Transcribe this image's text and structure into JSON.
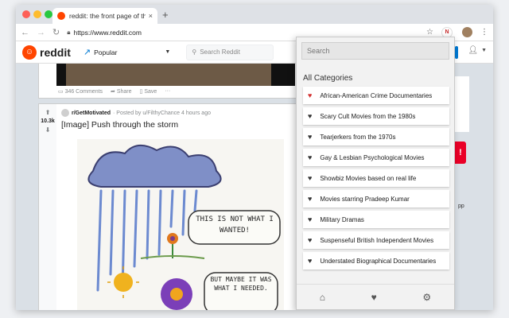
{
  "browser": {
    "tab_title": "reddit: the front page of the in",
    "tab_close": "×",
    "new_tab": "+",
    "url": "https://www.reddit.com",
    "extension_label": "N"
  },
  "reddit": {
    "wordmark": "reddit",
    "feed_selector": "Popular",
    "search_placeholder": "Search Reddit"
  },
  "post_prev": {
    "comments": "346 Comments",
    "share": "Share",
    "save": "Save",
    "more": "···"
  },
  "post": {
    "score": "10.3k",
    "subreddit": "r/GetMotivated",
    "posted_by": "· Posted by u/FilthyChance 4 hours ago",
    "title": "[Image] Push through the storm",
    "bubble1": "THIS IS NOT WHAT I WANTED!",
    "bubble2": "BUT MAYBE IT WAS WHAT I NEEDED."
  },
  "sidebar": {
    "partial_text": "pp"
  },
  "popup": {
    "search_placeholder": "Search",
    "heading": "All Categories",
    "categories": [
      {
        "label": "African-American Crime Documentaries",
        "favorite": true
      },
      {
        "label": "Scary Cult Movies from the 1980s",
        "favorite": false
      },
      {
        "label": "Tearjerkers from the 1970s",
        "favorite": false
      },
      {
        "label": "Gay & Lesbian Psychological Movies",
        "favorite": false
      },
      {
        "label": "Showbiz Movies based on real life",
        "favorite": false
      },
      {
        "label": "Movies starring Pradeep Kumar",
        "favorite": false
      },
      {
        "label": "Military Dramas",
        "favorite": false
      },
      {
        "label": "Suspenseful British Independent Movies",
        "favorite": false
      },
      {
        "label": "Understated Biographical Documentaries",
        "favorite": false
      }
    ],
    "footer_icons": [
      "home-icon",
      "heart-icon",
      "settings-icon"
    ]
  },
  "colors": {
    "reddit_orange": "#ff4500",
    "reddit_blue": "#0079d3",
    "favorite_red": "#d32f2f"
  }
}
